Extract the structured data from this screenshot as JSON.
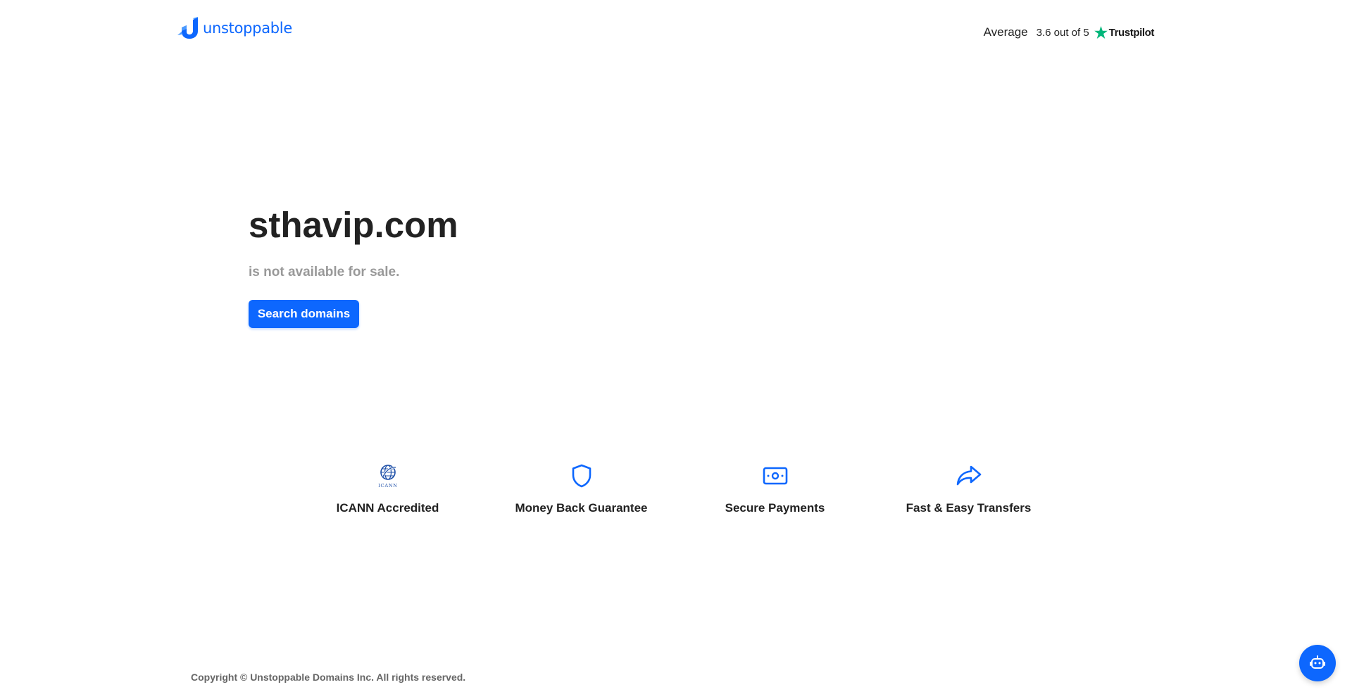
{
  "header": {
    "logo_text": "unstoppable",
    "rating": {
      "label": "Average",
      "score": "3.6 out of 5",
      "brand": "Trustpilot"
    }
  },
  "hero": {
    "domain": "sthavip.com",
    "status": "is not available for sale.",
    "search_button": "Search domains"
  },
  "features": [
    {
      "icon": "icann-logo-icon",
      "label": "ICANN Accredited",
      "icon_text": "ICANN"
    },
    {
      "icon": "shield-icon",
      "label": "Money Back Guarantee"
    },
    {
      "icon": "cash-icon",
      "label": "Secure Payments"
    },
    {
      "icon": "share-arrow-icon",
      "label": "Fast & Easy Transfers"
    }
  ],
  "footer": {
    "copyright": "Copyright © Unstoppable Domains Inc. All rights reserved."
  },
  "chat": {
    "icon": "robot-icon"
  },
  "colors": {
    "brand_blue": "#0d67fe",
    "trustpilot_green": "#00b67a",
    "title_text": "#222222",
    "muted_text": "#999999",
    "footer_text": "#666666"
  }
}
